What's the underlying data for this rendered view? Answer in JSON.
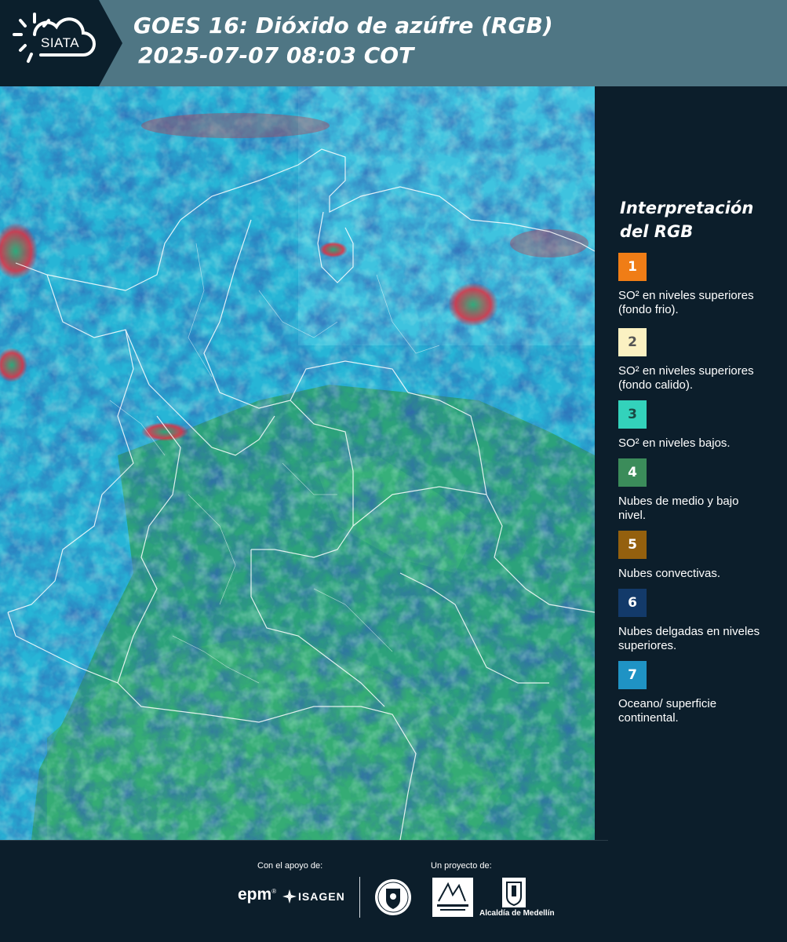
{
  "header": {
    "logo_text": "SIATA",
    "title_line1": "GOES 16: Dióxido de azúfre (RGB)",
    "title_line2": "2025-07-07 08:03 COT"
  },
  "legend": {
    "title_line1": "Interpretación",
    "title_line2": "del RGB",
    "items": [
      {
        "number": "1",
        "label": "SO² en niveles superiores (fondo frio).",
        "color": "#f07d16",
        "text_color": "#ffffff"
      },
      {
        "number": "2",
        "label": "SO² en niveles superiores (fondo calido).",
        "color": "#fbf1c2",
        "text_color": "#555555"
      },
      {
        "number": "3",
        "label": "SO² en niveles bajos.",
        "color": "#33d2bb",
        "text_color": "#1a4a44"
      },
      {
        "number": "4",
        "label": "Nubes de medio y bajo nivel.",
        "color": "#3b8c5a",
        "text_color": "#ffffff"
      },
      {
        "number": "5",
        "label": "Nubes convectivas.",
        "color": "#94600e",
        "text_color": "#ffffff"
      },
      {
        "number": "6",
        "label": "Nubes delgadas en niveles superiores.",
        "color": "#133a6a",
        "text_color": "#ffffff"
      },
      {
        "number": "7",
        "label": "Oceano/ superficie continental.",
        "color": "#1f93c4",
        "text_color": "#ffffff"
      }
    ]
  },
  "footer": {
    "support_label": "Con el apoyo de:",
    "project_label": "Un proyecto de:",
    "epm": "epm",
    "isagen": "ISAGEN",
    "alcaldia": "Alcaldía de Medellín"
  },
  "colors": {
    "header_bg": "#4f7684",
    "panel_bg": "#0c1e2b",
    "map_ocean": "#27b5d6",
    "map_land": "#2f9f6e"
  }
}
